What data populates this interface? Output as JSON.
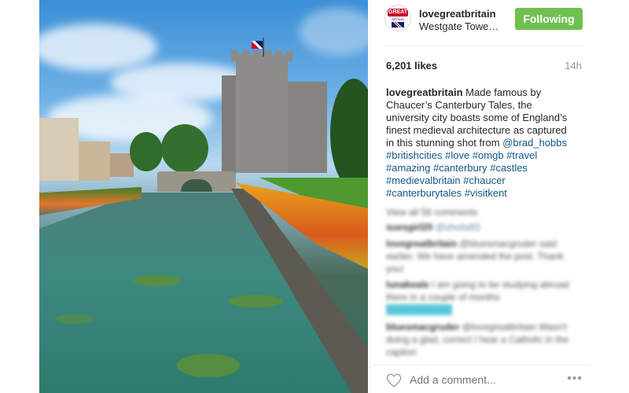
{
  "post": {
    "username": "lovegreatbritain",
    "location": "Westgate Towers, Canterbury",
    "follow_label": "Following",
    "likes": "6,201 likes",
    "time_ago": "14h",
    "caption": {
      "user": "lovegreatbritain",
      "text": "Made famous by Chaucer’s Canterbury Tales, the university city boasts some of England’s finest medieval architecture as captured in this stunning shot from",
      "mention": "@brad_hobbs",
      "hashtags": "#britishcities #love #omgb #travel #amazing #canterbury #castles #medievalbritain #chaucer #canterburytales #visitkent"
    },
    "avatar_logo": {
      "top": "GREAT",
      "sub": "BRITAIN"
    }
  },
  "comments_blurred": [
    {
      "line": "View all 58 comments"
    },
    {
      "user": "suesgirl20",
      "text": "@sheila83"
    },
    {
      "user": "lovegreatbritain",
      "text": "@bluesmacgruder said earlier. We have amended the post. Thank you!"
    },
    {
      "user": "lunakeale",
      "text": "I am going to be studying abroad there in a couple of months"
    },
    {
      "user": "",
      "text": "#visitcanterbury"
    },
    {
      "user": "bluesmacgruder",
      "text": "@lovegreatbritain Wasn't doing a glad, correct I hear a Catholic in the caption"
    }
  ],
  "footer": {
    "placeholder": "Add a comment...",
    "more": "•••"
  },
  "colors": {
    "follow_bg": "#70c050",
    "link": "#125688"
  },
  "icons": [
    "heart-icon",
    "more-options-icon",
    "avatar-logo-icon"
  ]
}
